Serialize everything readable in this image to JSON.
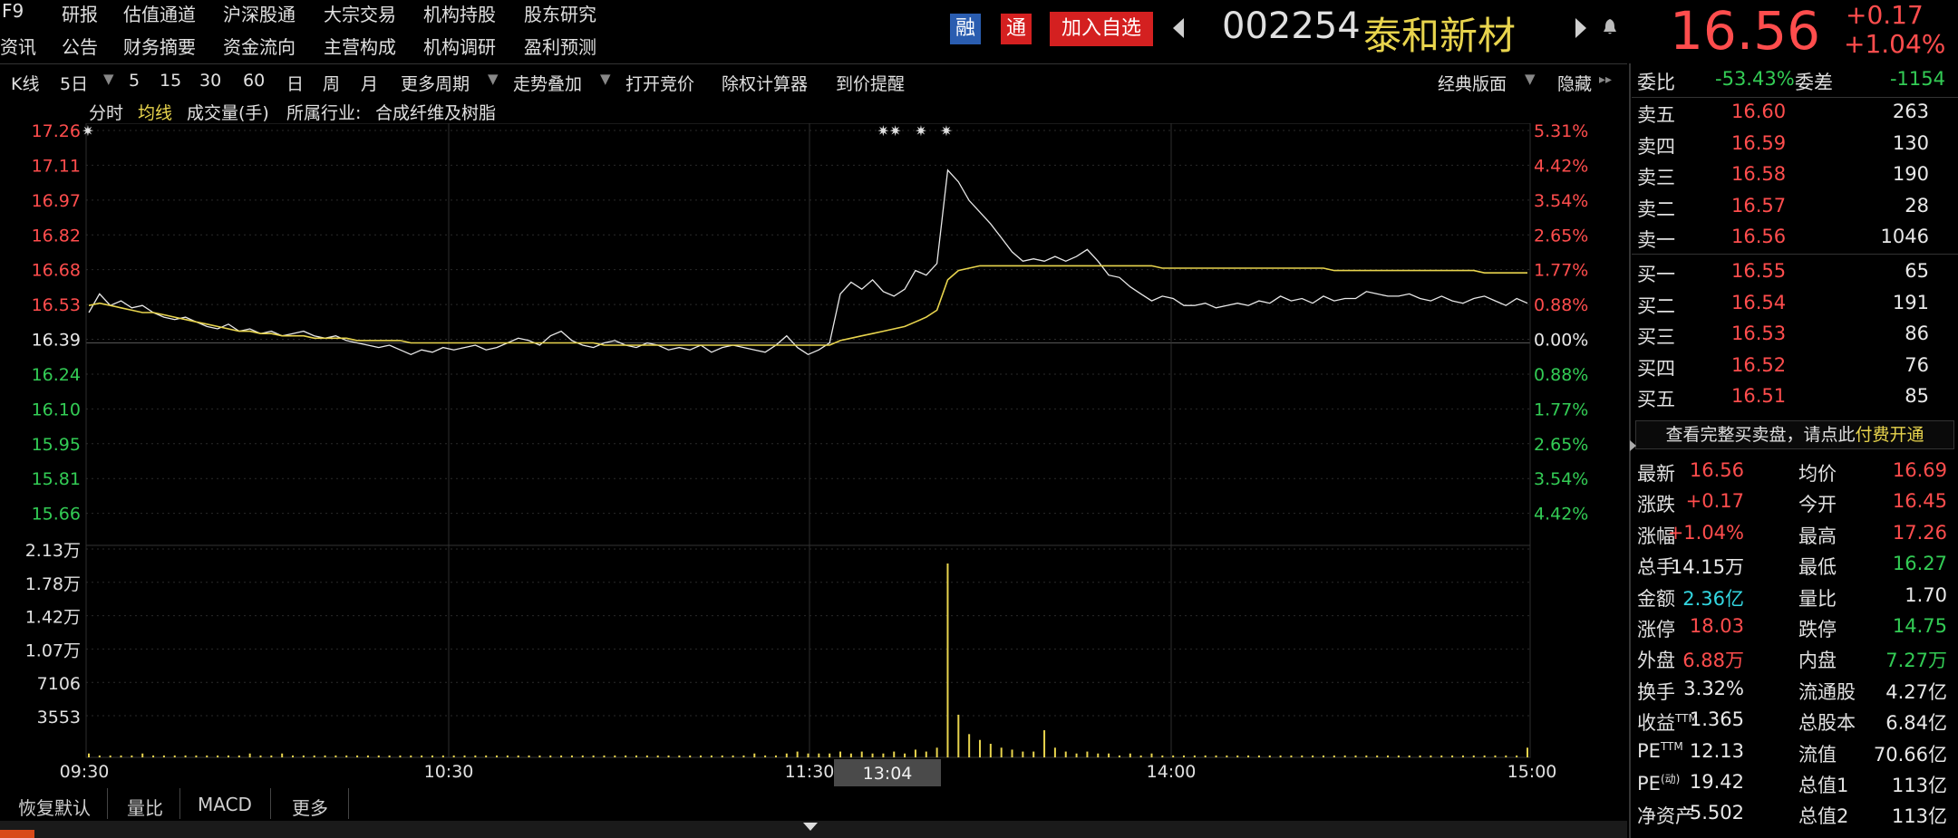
{
  "nav": {
    "row1": [
      "F9",
      "研报",
      "估值通道",
      "沪深股通",
      "大宗交易",
      "机构持股",
      "股东研究"
    ],
    "row2": [
      "资讯",
      "公告",
      "财务摘要",
      "资金流向",
      "主营构成",
      "机构调研",
      "盈利预测"
    ]
  },
  "header": {
    "badge_rong": "融",
    "badge_tong": "通",
    "add_watch": "加入自选",
    "code": "002254",
    "name": "泰和新材",
    "price": "16.56",
    "change": "+0.17",
    "change_pct": "+1.04%"
  },
  "toolbar": {
    "items": [
      "K线",
      "5日",
      "5",
      "15",
      "30",
      "60",
      "日",
      "周",
      "月",
      "更多周期",
      "走势叠加",
      "打开竞价",
      "除权计算器",
      "到价提醒"
    ],
    "classic": "经典版面",
    "hide": "隐藏"
  },
  "chart_header": {
    "timeshare": "分时",
    "avg_line": "均线",
    "volume": "成交量(手)",
    "industry_label": "所属行业:",
    "industry": "合成纤维及树脂"
  },
  "chart_data": {
    "type": "line",
    "price_ticks": [
      "17.26",
      "17.11",
      "16.97",
      "16.82",
      "16.68",
      "16.53",
      "16.39",
      "16.24",
      "16.10",
      "15.95",
      "15.81",
      "15.66"
    ],
    "pct_ticks": [
      "5.31%",
      "4.42%",
      "3.54%",
      "2.65%",
      "1.77%",
      "0.88%",
      "0.00%",
      "0.88%",
      "1.77%",
      "2.65%",
      "3.54%",
      "4.42%"
    ],
    "volume_ticks": [
      "2.13万",
      "1.78万",
      "1.42万",
      "1.07万",
      "7106",
      "3553"
    ],
    "time_ticks": [
      "09:30",
      "10:30",
      "11:30",
      "14:00",
      "15:00"
    ],
    "cursor_time": "13:04",
    "prev_close": 16.39,
    "ylim": [
      15.6,
      17.3
    ],
    "series": [
      {
        "name": "分时",
        "values": [
          16.52,
          16.6,
          16.55,
          16.57,
          16.54,
          16.55,
          16.52,
          16.5,
          16.49,
          16.5,
          16.48,
          16.46,
          16.45,
          16.47,
          16.44,
          16.45,
          16.43,
          16.44,
          16.42,
          16.43,
          16.44,
          16.42,
          16.41,
          16.42,
          16.4,
          16.39,
          16.38,
          16.37,
          16.38,
          16.36,
          16.34,
          16.36,
          16.35,
          16.37,
          16.36,
          16.37,
          16.38,
          16.36,
          16.37,
          16.39,
          16.41,
          16.4,
          16.38,
          16.42,
          16.44,
          16.4,
          16.38,
          16.37,
          16.39,
          16.4,
          16.38,
          16.37,
          16.39,
          16.38,
          16.36,
          16.37,
          16.36,
          16.38,
          16.35,
          16.37,
          16.38,
          16.37,
          16.36,
          16.35,
          16.38,
          16.42,
          16.37,
          16.34,
          16.36,
          16.39,
          16.6,
          16.65,
          16.62,
          16.66,
          16.61,
          16.59,
          16.62,
          16.7,
          16.68,
          16.73,
          17.13,
          17.08,
          17.0,
          16.95,
          16.9,
          16.84,
          16.78,
          16.74,
          16.75,
          16.74,
          16.76,
          16.74,
          16.76,
          16.79,
          16.74,
          16.68,
          16.67,
          16.63,
          16.6,
          16.57,
          16.59,
          16.58,
          16.55,
          16.55,
          16.56,
          16.54,
          16.55,
          16.56,
          16.55,
          16.57,
          16.56,
          16.59,
          16.57,
          16.58,
          16.56,
          16.59,
          16.57,
          16.58,
          16.58,
          16.61,
          16.6,
          16.59,
          16.59,
          16.6,
          16.58,
          16.57,
          16.59,
          16.57,
          16.56,
          16.58,
          16.59,
          16.57,
          16.55,
          16.58,
          16.56
        ]
      },
      {
        "name": "均线",
        "values": [
          16.55,
          16.56,
          16.55,
          16.54,
          16.53,
          16.52,
          16.52,
          16.51,
          16.5,
          16.49,
          16.48,
          16.47,
          16.46,
          16.45,
          16.44,
          16.44,
          16.43,
          16.43,
          16.42,
          16.42,
          16.42,
          16.41,
          16.41,
          16.41,
          16.41,
          16.4,
          16.4,
          16.4,
          16.4,
          16.4,
          16.39,
          16.39,
          16.39,
          16.39,
          16.39,
          16.39,
          16.39,
          16.39,
          16.39,
          16.39,
          16.39,
          16.39,
          16.39,
          16.39,
          16.39,
          16.39,
          16.39,
          16.39,
          16.38,
          16.38,
          16.38,
          16.38,
          16.38,
          16.38,
          16.38,
          16.38,
          16.38,
          16.38,
          16.38,
          16.38,
          16.38,
          16.38,
          16.38,
          16.38,
          16.38,
          16.38,
          16.38,
          16.38,
          16.38,
          16.38,
          16.4,
          16.41,
          16.42,
          16.43,
          16.44,
          16.45,
          16.46,
          16.48,
          16.5,
          16.53,
          16.66,
          16.7,
          16.71,
          16.72,
          16.72,
          16.72,
          16.72,
          16.72,
          16.72,
          16.72,
          16.72,
          16.72,
          16.72,
          16.72,
          16.72,
          16.72,
          16.72,
          16.72,
          16.72,
          16.72,
          16.71,
          16.71,
          16.71,
          16.71,
          16.71,
          16.71,
          16.71,
          16.71,
          16.71,
          16.71,
          16.71,
          16.71,
          16.71,
          16.71,
          16.71,
          16.71,
          16.7,
          16.7,
          16.7,
          16.7,
          16.7,
          16.7,
          16.7,
          16.7,
          16.7,
          16.7,
          16.7,
          16.7,
          16.7,
          16.7,
          16.69,
          16.69,
          16.69,
          16.69,
          16.69
        ]
      }
    ],
    "volume": [
      2,
      1,
      1,
      1,
      1,
      2,
      1,
      1,
      1,
      1,
      1,
      1,
      1,
      1,
      1,
      2,
      1,
      1,
      2,
      1,
      1,
      1,
      1,
      1,
      1,
      1,
      1,
      1,
      1,
      1,
      1,
      1,
      1,
      1,
      1,
      1,
      1,
      1,
      1,
      1,
      1,
      1,
      1,
      1,
      1,
      1,
      1,
      1,
      1,
      1,
      1,
      1,
      1,
      1,
      1,
      1,
      1,
      1,
      1,
      1,
      1,
      1,
      2,
      1,
      1,
      2,
      3,
      2,
      2,
      2,
      3,
      2,
      3,
      2,
      2,
      3,
      2,
      4,
      3,
      5,
      100,
      22,
      12,
      9,
      7,
      5,
      4,
      3,
      3,
      14,
      5,
      3,
      2,
      3,
      2,
      2,
      1,
      2,
      1,
      2,
      1,
      1,
      1,
      1,
      1,
      1,
      1,
      1,
      1,
      1,
      1,
      1,
      1,
      1,
      1,
      1,
      1,
      1,
      1,
      1,
      1,
      1,
      1,
      1,
      1,
      1,
      1,
      1,
      1,
      1,
      1,
      1,
      1,
      1,
      5
    ],
    "volume_max": 21300
  },
  "markers": [
    "✷",
    "✷✷",
    "✷",
    "✷"
  ],
  "order_book": {
    "ratio_label": "委比",
    "ratio": "-53.43%",
    "diff_label": "委差",
    "diff": "-1154",
    "asks": [
      {
        "label": "卖五",
        "price": "16.60",
        "vol": "263"
      },
      {
        "label": "卖四",
        "price": "16.59",
        "vol": "130"
      },
      {
        "label": "卖三",
        "price": "16.58",
        "vol": "190"
      },
      {
        "label": "卖二",
        "price": "16.57",
        "vol": "28"
      },
      {
        "label": "卖一",
        "price": "16.56",
        "vol": "1046"
      }
    ],
    "bids": [
      {
        "label": "买一",
        "price": "16.55",
        "vol": "65"
      },
      {
        "label": "买二",
        "price": "16.54",
        "vol": "191"
      },
      {
        "label": "买三",
        "price": "16.53",
        "vol": "86"
      },
      {
        "label": "买四",
        "price": "16.52",
        "vol": "76"
      },
      {
        "label": "买五",
        "price": "16.51",
        "vol": "85"
      }
    ],
    "promo_text": "查看完整买卖盘，请点此",
    "promo_link": "付费开通"
  },
  "stats": [
    {
      "l1": "最新",
      "v1": "16.56",
      "c1": "red",
      "l2": "均价",
      "v2": "16.69",
      "c2": "red"
    },
    {
      "l1": "涨跌",
      "v1": "+0.17",
      "c1": "red",
      "l2": "今开",
      "v2": "16.45",
      "c2": "red"
    },
    {
      "l1": "涨幅",
      "v1": "+1.04%",
      "c1": "red",
      "l2": "最高",
      "v2": "17.26",
      "c2": "red"
    },
    {
      "l1": "总手",
      "v1": "14.15万",
      "c1": "white",
      "l2": "最低",
      "v2": "16.27",
      "c2": "green"
    },
    {
      "l1": "金额",
      "v1": "2.36亿",
      "c1": "cyan",
      "l2": "量比",
      "v2": "1.70",
      "c2": "white"
    },
    {
      "l1": "涨停",
      "v1": "18.03",
      "c1": "red",
      "l2": "跌停",
      "v2": "14.75",
      "c2": "green"
    },
    {
      "l1": "外盘",
      "v1": "6.88万",
      "c1": "red",
      "l2": "内盘",
      "v2": "7.27万",
      "c2": "green"
    },
    {
      "l1": "换手",
      "v1": "3.32%",
      "c1": "white",
      "l2": "流通股",
      "v2": "4.27亿",
      "c2": "white"
    },
    {
      "l1": "收益",
      "l1sup": "TTM",
      "v1": "1.365",
      "c1": "white",
      "l2": "总股本",
      "v2": "6.84亿",
      "c2": "white"
    },
    {
      "l1": "PE",
      "l1sup": "TTM",
      "v1": "12.13",
      "c1": "white",
      "l2": "流值",
      "v2": "70.66亿",
      "c2": "white"
    },
    {
      "l1": "PE",
      "l1sup": "(动)",
      "v1": "19.42",
      "c1": "white",
      "l2": "总值1",
      "v2": "113亿",
      "c2": "white"
    },
    {
      "l1": "净资产",
      "v1": "5.502",
      "c1": "white",
      "l2": "总值2",
      "v2": "113亿",
      "c2": "white"
    }
  ],
  "bottom_tabs": [
    "恢复默认",
    "量比",
    "MACD",
    "更多"
  ],
  "colors": {
    "up": "#ff4d4d",
    "down": "#33cc55",
    "price_line": "#e8e8e8",
    "avg_line": "#e8d44d",
    "grid": "#2a2a2a",
    "volume": "#e8d44d"
  }
}
